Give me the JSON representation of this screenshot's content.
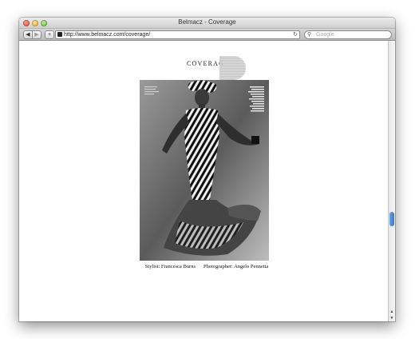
{
  "window": {
    "title": "Belmacz - Coverage"
  },
  "toolbar": {
    "back_label": "◀",
    "forward_label": "▶",
    "add_label": "+",
    "url": "http://www.belmacz.com/coverage/",
    "reload_icon": "reload-icon",
    "search_placeholder": "Google"
  },
  "page": {
    "heading": "COVERAG",
    "stylist": "Stylist: Francesca Burns",
    "photographer": "Photographer: Angelo Pennetta"
  }
}
